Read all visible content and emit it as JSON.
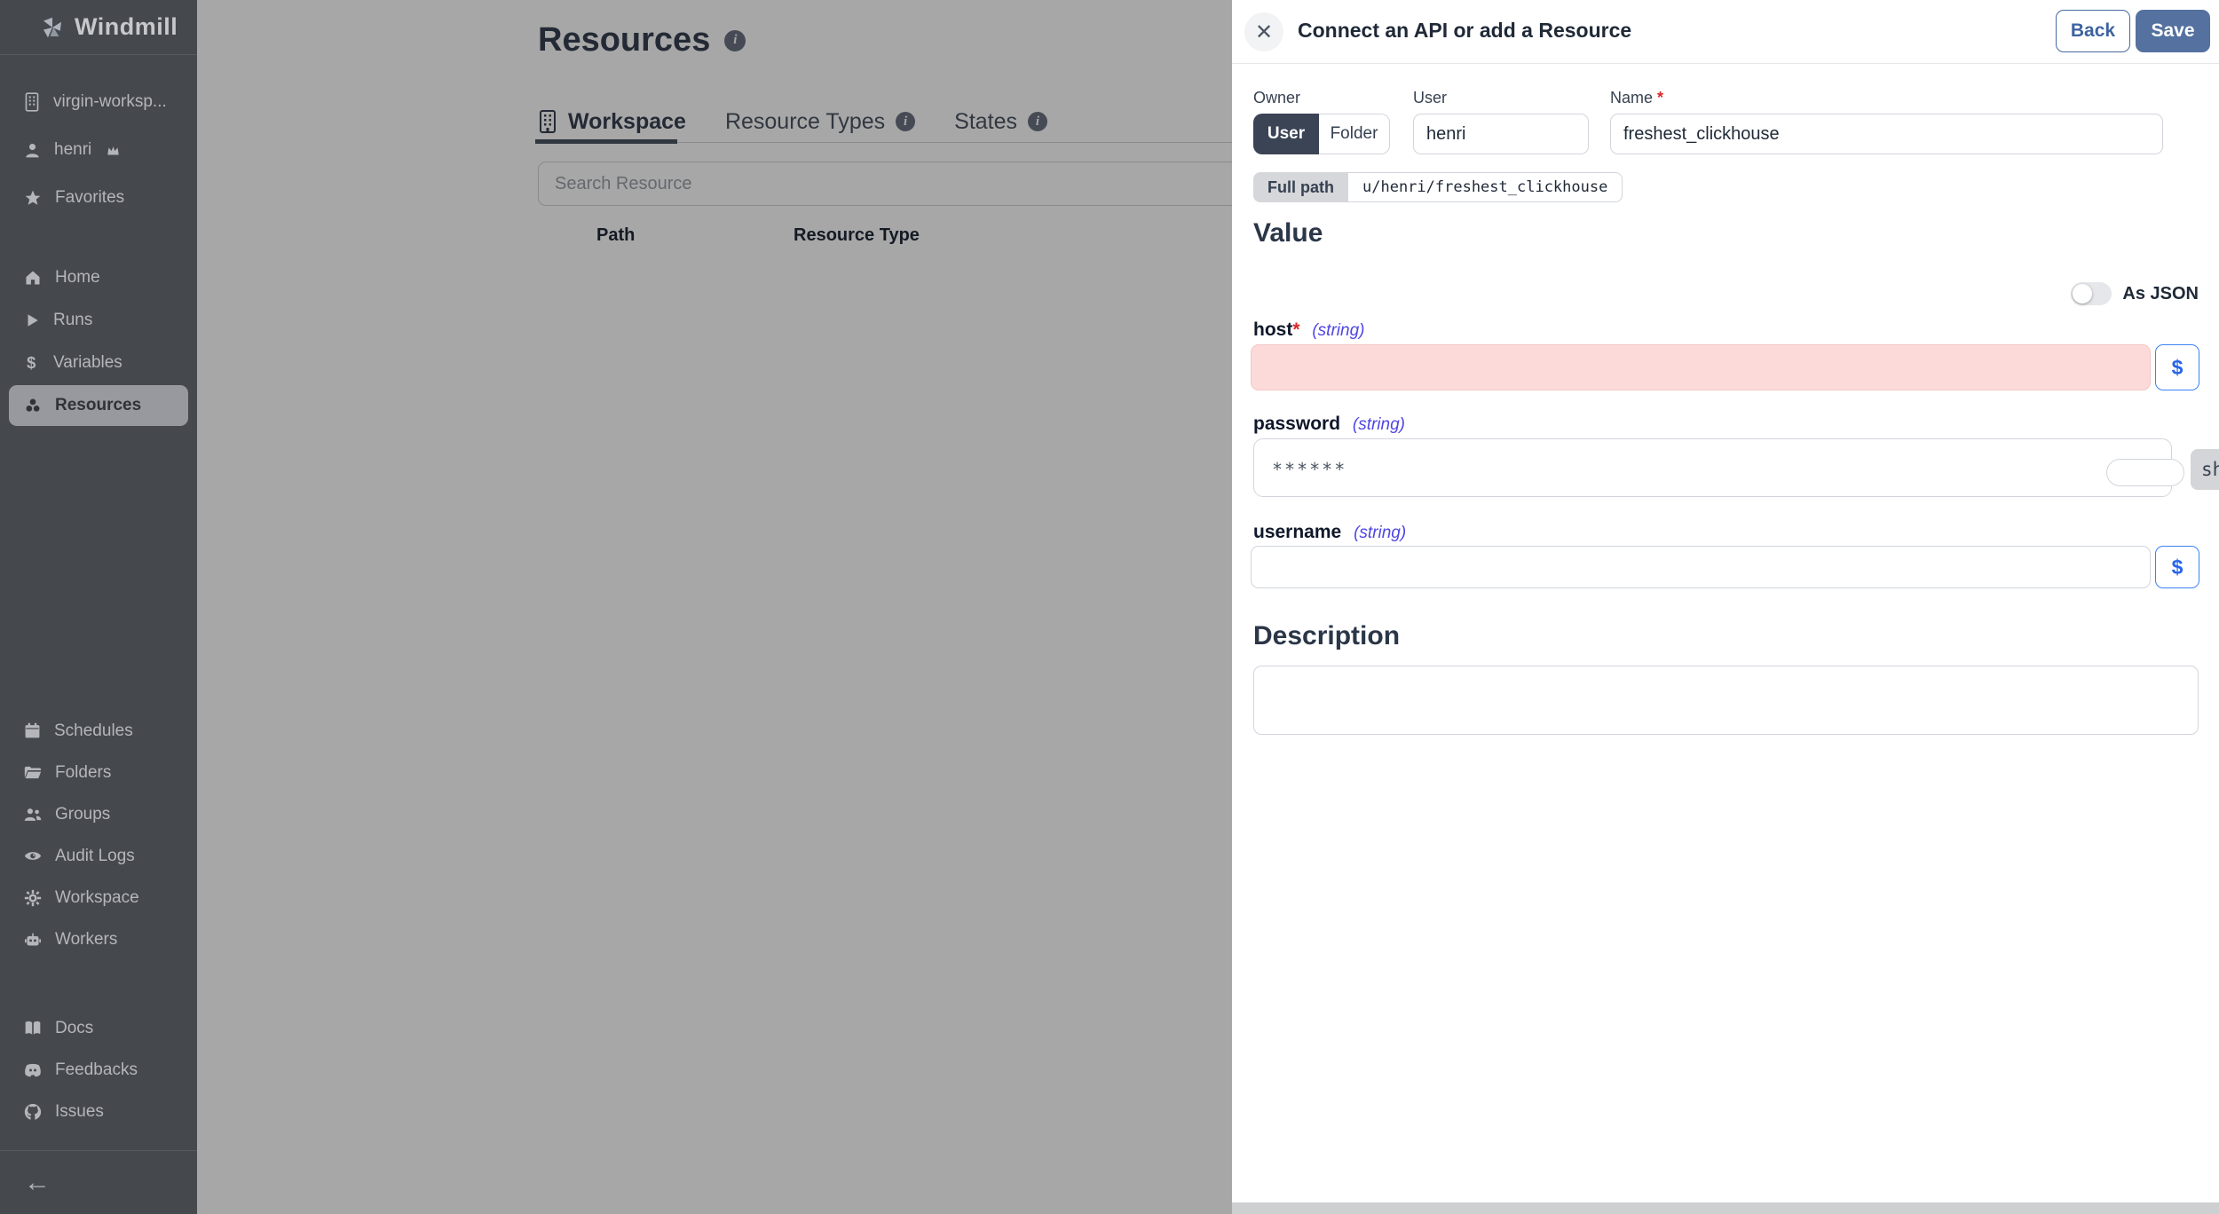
{
  "app": {
    "brand": "Windmill"
  },
  "sidebar": {
    "workspace_name": "virgin-worksp...",
    "user_name": "henri",
    "favorites_label": "Favorites",
    "items": [
      {
        "label": "Home"
      },
      {
        "label": "Runs"
      },
      {
        "label": "Variables"
      },
      {
        "label": "Resources",
        "active": true
      }
    ],
    "admin_items": [
      {
        "label": "Schedules"
      },
      {
        "label": "Folders"
      },
      {
        "label": "Groups"
      },
      {
        "label": "Audit Logs"
      },
      {
        "label": "Workspace"
      },
      {
        "label": "Workers"
      }
    ],
    "footer_items": [
      {
        "label": "Docs"
      },
      {
        "label": "Feedbacks"
      },
      {
        "label": "Issues"
      }
    ],
    "collapse_icon": "left-arrow"
  },
  "main": {
    "title": "Resources",
    "tabs": [
      {
        "label": "Workspace",
        "active": true
      },
      {
        "label": "Resource Types",
        "active": false
      },
      {
        "label": "States",
        "active": false
      }
    ],
    "search_placeholder": "Search Resource",
    "table": {
      "columns": [
        "Path",
        "Resource Type"
      ]
    }
  },
  "drawer": {
    "title": "Connect an API or add a Resource",
    "back_label": "Back",
    "save_label": "Save",
    "owner": {
      "label": "Owner",
      "selected": "User",
      "other": "Folder"
    },
    "user_field": {
      "label": "User",
      "value": "henri"
    },
    "name_field": {
      "label": "Name",
      "required": "*",
      "value": "freshest_clickhouse"
    },
    "full_path": {
      "label": "Full path",
      "value": "u/henri/freshest_clickhouse"
    },
    "value_section": {
      "heading": "Value",
      "as_json_label": "As JSON",
      "as_json_enabled": false
    },
    "fields": {
      "host": {
        "name": "host",
        "required": "*",
        "type": "(string)",
        "value": "",
        "invalid": true
      },
      "password": {
        "name": "password",
        "type": "(string)",
        "masked_value": "******",
        "show_label": "sh"
      },
      "username": {
        "name": "username",
        "type": "(string)",
        "value": ""
      }
    },
    "insert_var_label": "$",
    "description_section": {
      "heading": "Description",
      "value": ""
    }
  },
  "colors": {
    "sidebar_bg": "#45484d",
    "save_button": "#54719f",
    "owner_active": "#3b4455",
    "invalid_field_bg": "#fcdada",
    "type_tag": "#4f46e5",
    "dollar_accent": "#2563eb",
    "overlay": "rgba(0,0,0,0.345)"
  }
}
